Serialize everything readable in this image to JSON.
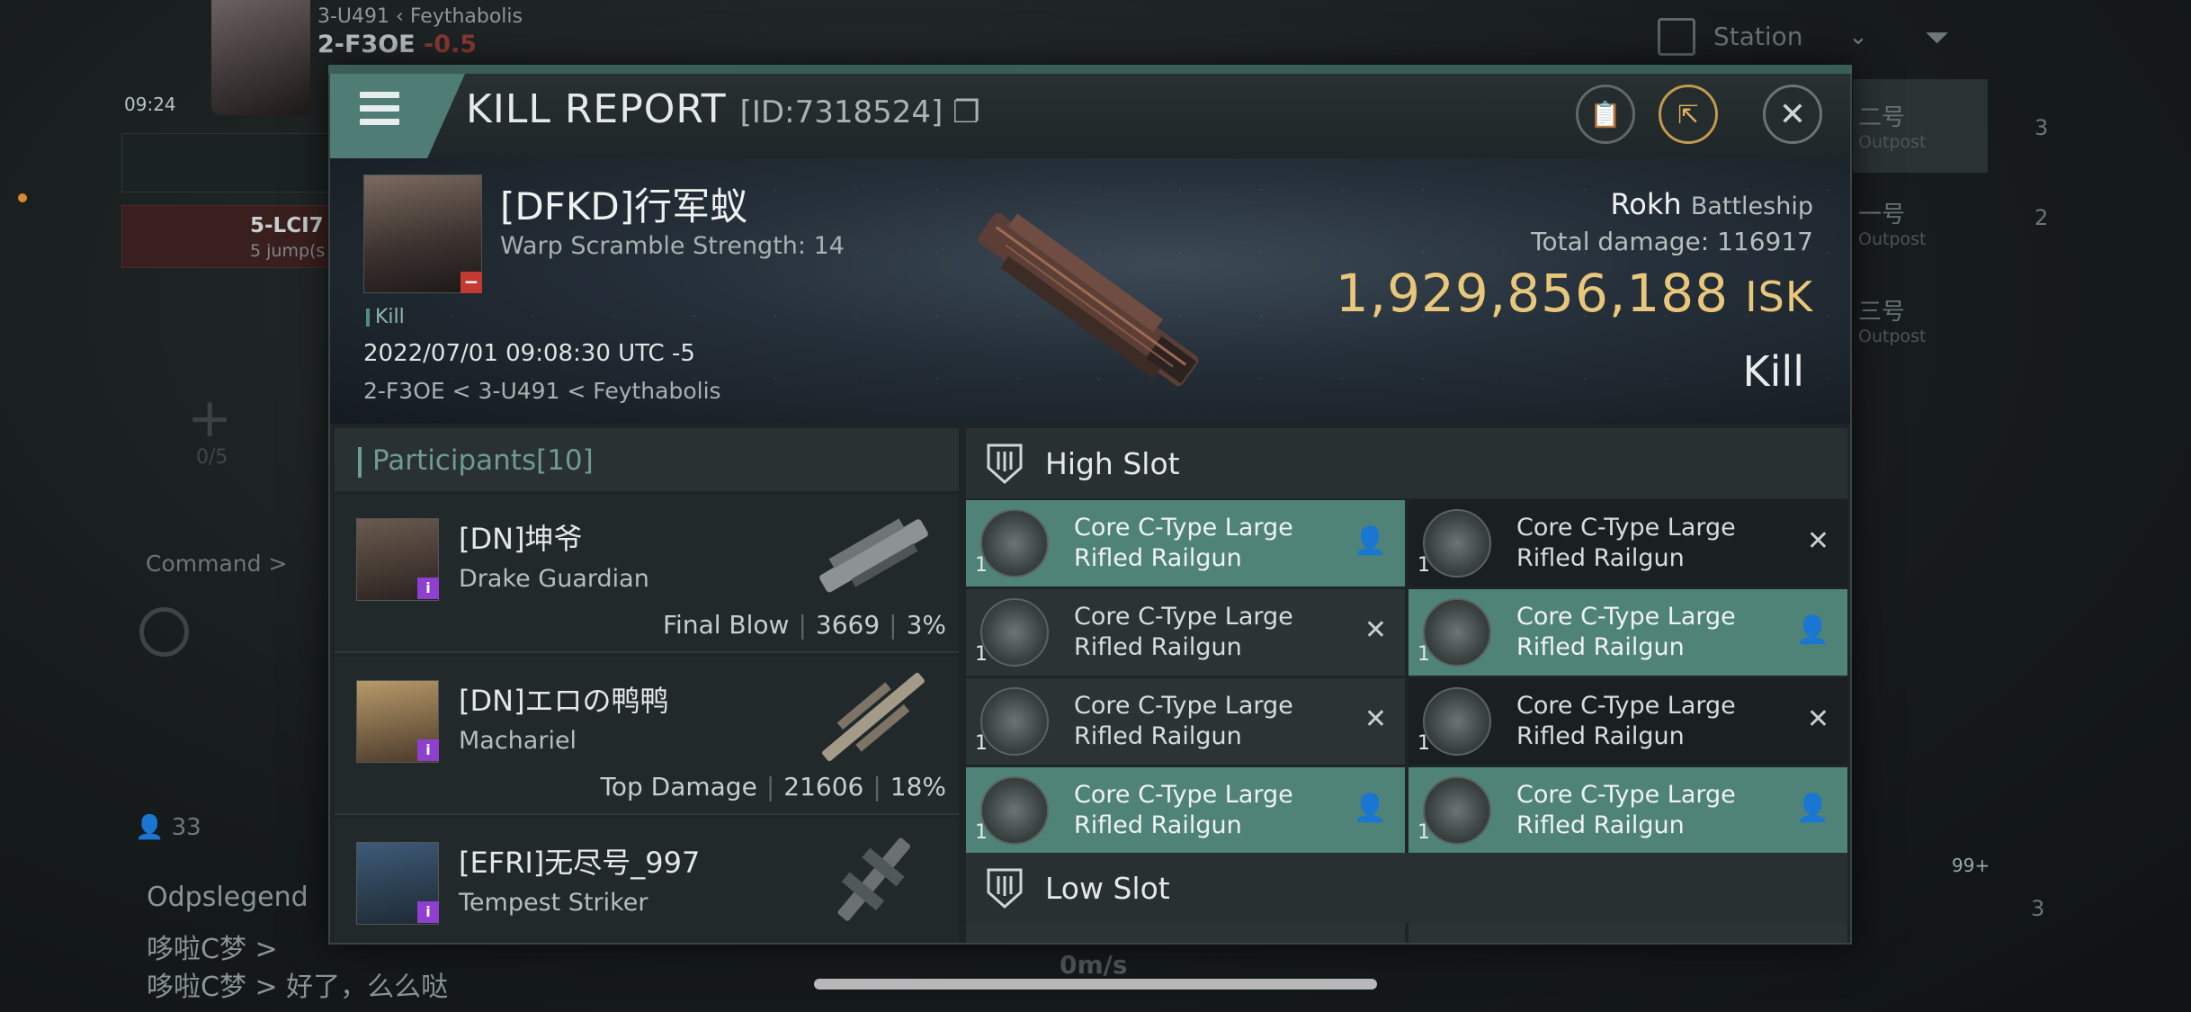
{
  "background": {
    "player": {
      "system": "3-U491",
      "region": "Feythabolis",
      "location": "2-F3OE",
      "security": "-0.5",
      "clock": "09:24"
    },
    "route": {
      "destination": "5-LCI7",
      "jumps": "5 jump(s"
    },
    "fleet": {
      "count": "0/5",
      "command_label": "Command >"
    },
    "chat": {
      "count": "33",
      "lines": [
        "Odpslegend",
        "哆啦C梦 > ",
        "哆啦C梦 > 好了，么么哒"
      ]
    },
    "overview": {
      "filter_label": "Station",
      "entries": [
        {
          "name": "二号",
          "type": "Outpost"
        },
        {
          "name": "一号",
          "type": "Outpost"
        },
        {
          "name": "三号",
          "type": "Outpost"
        }
      ],
      "counts": [
        "3",
        "2"
      ]
    },
    "speed": "0m/s",
    "badge_count": "99+",
    "drone_count": "3"
  },
  "report": {
    "title": "KILL REPORT",
    "id": "[ID:7318524]",
    "victim": {
      "name": "[DFKD]行军蚁",
      "warp_scramble": "Warp Scramble Strength: 14",
      "tag": "Kill",
      "datetime": "2022/07/01 09:08:30 UTC -5",
      "location": "2-F3OE < 3-U491 < Feythabolis"
    },
    "ship": {
      "name": "Rokh",
      "class": "Battleship"
    },
    "total_damage_label": "Total damage:",
    "total_damage": "116917",
    "isk_value": "1,929,856,188",
    "isk_unit": "ISK",
    "result": "Kill"
  },
  "participants": {
    "label": "Participants",
    "count": "[10]",
    "rows": [
      {
        "name": "[DN]坤爷",
        "ship": "Drake Guardian",
        "stat_label": "Final Blow",
        "damage": "3669",
        "percent": "3%"
      },
      {
        "name": "[DN]エロの鸭鸭",
        "ship": "Machariel",
        "stat_label": "Top Damage",
        "damage": "21606",
        "percent": "18%"
      },
      {
        "name": "[EFRI]无尽号_997",
        "ship": "Tempest Striker",
        "stat_label": "",
        "damage": "",
        "percent": ""
      }
    ]
  },
  "slots": {
    "high_label": "High Slot",
    "low_label": "Low Slot",
    "high_items": [
      {
        "qty": "1",
        "line1": "Core C-Type Large",
        "line2": "Rifled Railgun",
        "state": "dropped"
      },
      {
        "qty": "1",
        "line1": "Core C-Type Large",
        "line2": "Rifled Railgun",
        "state": "destroyed"
      },
      {
        "qty": "1",
        "line1": "Core C-Type Large",
        "line2": "Rifled Railgun",
        "state": "destroyed"
      },
      {
        "qty": "1",
        "line1": "Core C-Type Large",
        "line2": "Rifled Railgun",
        "state": "dropped"
      },
      {
        "qty": "1",
        "line1": "Core C-Type Large",
        "line2": "Rifled Railgun",
        "state": "destroyed"
      },
      {
        "qty": "1",
        "line1": "Core C-Type Large",
        "line2": "Rifled Railgun",
        "state": "destroyed"
      },
      {
        "qty": "1",
        "line1": "Core C-Type Large",
        "line2": "Rifled Railgun",
        "state": "dropped"
      },
      {
        "qty": "1",
        "line1": "Core C-Type Large",
        "line2": "Rifled Railgun",
        "state": "dropped"
      }
    ],
    "state_icons": {
      "dropped": "person-icon",
      "destroyed": "x-icon"
    }
  }
}
